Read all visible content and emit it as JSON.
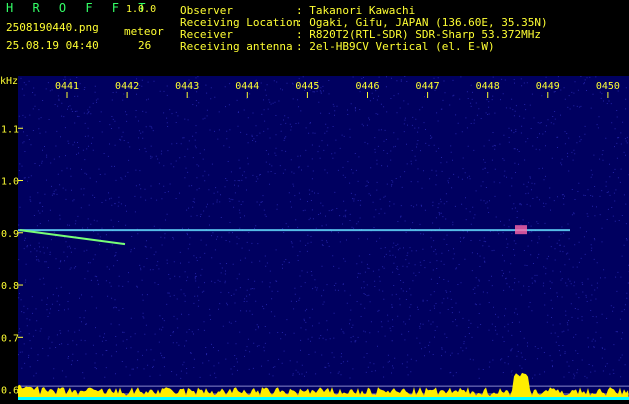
{
  "header": {
    "app_name": "H R O F F T",
    "version": "1.0.0",
    "filename": "2508190440.png",
    "datetime": "25.08.19 04:40",
    "meteor_label": "meteor",
    "meteor_count": "26"
  },
  "info": [
    {
      "label": "Observer",
      "value": ": Takanori Kawachi"
    },
    {
      "label": "Receiving Location",
      "value": ": Ogaki, Gifu, JAPAN (136.60E, 35.35N)"
    },
    {
      "label": "Receiver",
      "value": ": R820T2(RTL-SDR) SDR-Sharp 53.372MHz"
    },
    {
      "label": "Receiving antenna",
      "value": ": 2el-HB9CV Vertical (el. E-W)"
    }
  ],
  "spectrogram": {
    "unit_label": "kHz",
    "time_labels": [
      "0441",
      "0442",
      "0443",
      "0444",
      "0445",
      "0446",
      "0447",
      "0448",
      "0449",
      "0450"
    ],
    "freq_labels": [
      "1.1",
      "1.0",
      "0.9",
      "0.8",
      "0.7",
      "0.6"
    ],
    "freq_values": [
      1.1,
      1.0,
      0.9,
      0.8,
      0.7,
      0.6
    ],
    "freq_range": [
      0.58,
      1.2
    ],
    "carrier_khz": 0.905,
    "colors": {
      "background": "#000060",
      "grid": "#2a2a9a",
      "labels": "#ffff33",
      "carrier": "#66ddff",
      "meteor_echo": "#77ff77",
      "power_fill": "#ffee00",
      "power_base": "#00ffff"
    }
  }
}
